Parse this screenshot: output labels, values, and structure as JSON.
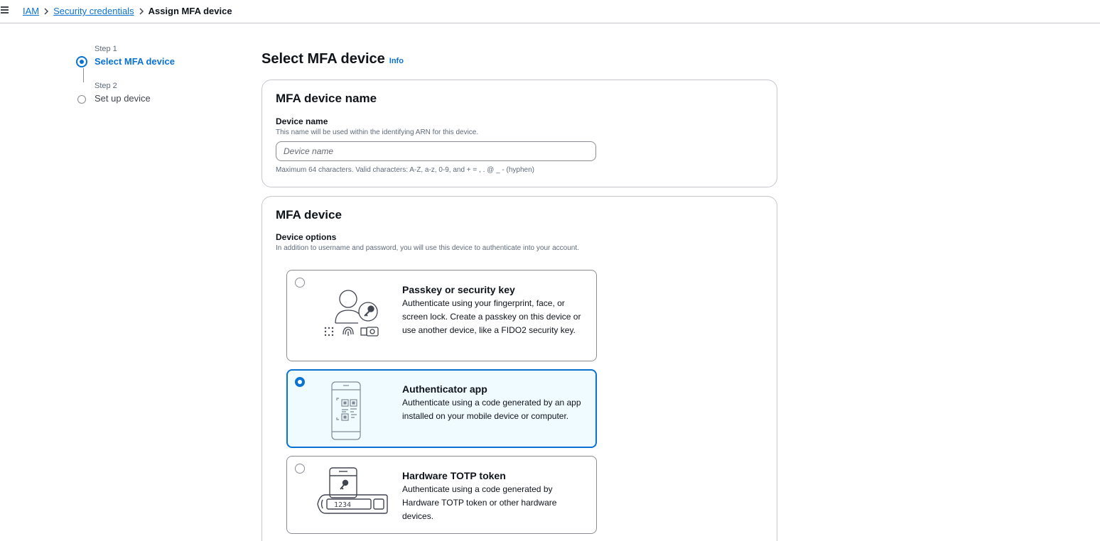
{
  "breadcrumb": {
    "items": [
      "IAM",
      "Security credentials"
    ],
    "current": "Assign MFA device"
  },
  "steps": [
    {
      "caption": "Step 1",
      "title": "Select MFA device",
      "state": "active"
    },
    {
      "caption": "Step 2",
      "title": "Set up device",
      "state": "inactive"
    }
  ],
  "page": {
    "title": "Select MFA device",
    "info": "Info"
  },
  "device_name_panel": {
    "title": "MFA device name",
    "label": "Device name",
    "description": "This name will be used within the identifying ARN for this device.",
    "placeholder": "Device name",
    "value": "",
    "constraint": "Maximum 64 characters. Valid characters: A-Z, a-z, 0-9, and + = , . @ _ - (hyphen)"
  },
  "device_panel": {
    "title": "MFA device",
    "label": "Device options",
    "description": "In addition to username and password, you will use this device to authenticate into your account.",
    "selected": "Authenticator app",
    "options": [
      {
        "title": "Passkey or security key",
        "description": "Authenticate using your fingerprint, face, or screen lock. Create a passkey on this device or use another device, like a FIDO2 security key.",
        "icon": "passkey-icon"
      },
      {
        "title": "Authenticator app",
        "description": "Authenticate using a code generated by an app installed on your mobile device or computer.",
        "icon": "authenticator-app-icon"
      },
      {
        "title": "Hardware TOTP token",
        "description": "Authenticate using a code generated by Hardware TOTP token or other hardware devices.",
        "icon": "hardware-token-icon",
        "token_display": "1234"
      }
    ]
  },
  "colors": {
    "accent": "#0972d3",
    "selected_bg": "#f0fbff",
    "border": "#8c8c94"
  }
}
